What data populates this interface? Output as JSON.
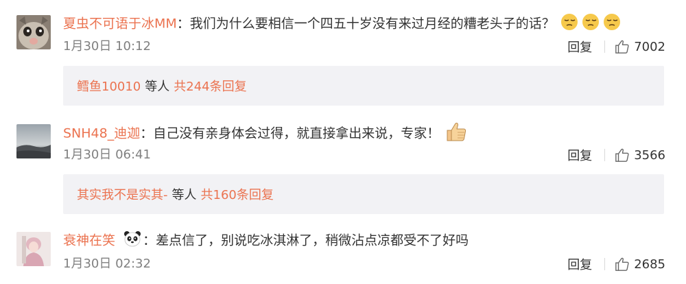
{
  "comments": [
    {
      "user": "夏虫不可语于冰MM",
      "text": "：我们为什么要相信一个四五十岁没有来过月经的糟老头子的话？",
      "emoji": "sleepy-face-emoji",
      "time": "1月30日 10:12",
      "reply_label": "回复",
      "likes": "7002",
      "replies": {
        "user": "鳕鱼10010",
        "mid": "等人",
        "total": "共244条回复"
      }
    },
    {
      "user": "SNH48_迪迦",
      "text": "：自己没有亲身体会过得，就直接拿出来说，专家！",
      "emoji": "thumbs-up-emoji",
      "time": "1月30日 06:41",
      "reply_label": "回复",
      "likes": "3566",
      "replies": {
        "user": "其实我不是实其-",
        "mid": "等人",
        "total": "共160条回复"
      }
    },
    {
      "user": "衰神在笑",
      "text": "：差点信了，别说吃冰淇淋了，稍微沾点凉都受不了好吗",
      "emoji": "panda-emoji",
      "time": "1月30日 02:32",
      "reply_label": "回复",
      "likes": "2685"
    }
  ],
  "colors": {
    "username": "#eb7350",
    "text": "#333333",
    "meta": "#808080",
    "reply_box": "#f2f2f5"
  }
}
